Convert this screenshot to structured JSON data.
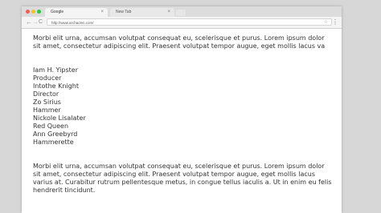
{
  "browser": {
    "tabs": [
      {
        "label": "Google",
        "active": true,
        "close": "×"
      },
      {
        "label": "New Tab",
        "active": false,
        "close": "×"
      }
    ],
    "nav": {
      "back": "←",
      "forward": "→",
      "reload": "C"
    },
    "url": "http://www.archaclen.com/",
    "star": "☆",
    "menu": "⋮"
  },
  "content": {
    "paragraph_1": "Morbi elit urna, accumsan volutpat consequat eu, scelerisque et purus. Lorem ipsum dolor sit amet, consectetur adipiscing elit. Praesent volutpat tempor augue, eget mollis lacus va",
    "names": [
      "Iam H. Yipster",
      "Producer",
      "Intothe Knight",
      "Director",
      "Zo Sirius",
      "Hammer",
      "Nickole Lisalater",
      "Red Queen",
      "Ann Greebyrd",
      "Hammerette"
    ],
    "paragraph_2": "Morbi elit urna, accumsan volutpat consequat eu, scelerisque et purus. Lorem ipsum dolor sit amet, consectetur adipiscing elit. Praesent volutpat tempor augue, eget mollis lacus varius at. Curabitur rutrum pellentesque metus, in congue tellus iaculis a. Ut in enim eu felis hendrerit tincidunt."
  }
}
